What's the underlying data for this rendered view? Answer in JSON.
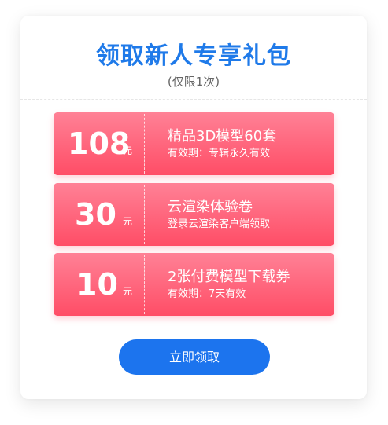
{
  "header": {
    "title": "领取新人专享礼包",
    "subtitle": "(仅限1次)"
  },
  "coupons": [
    {
      "amount": "108",
      "unit": "元",
      "name": "精品3D模型60套",
      "desc": "有效期：专辑永久有效"
    },
    {
      "amount": "30",
      "unit": "元",
      "name": "云渲染体验卷",
      "desc": "登录云渲染客户端领取"
    },
    {
      "amount": "10",
      "unit": "元",
      "name": "2张付费模型下载券",
      "desc": "有效期：7天有效"
    }
  ],
  "action": {
    "claim_label": "立即领取"
  },
  "colors": {
    "title": "#1f7ae9",
    "coupon_top": "#ff8196",
    "coupon_bottom": "#ff4d66",
    "button": "#1c74ee"
  }
}
